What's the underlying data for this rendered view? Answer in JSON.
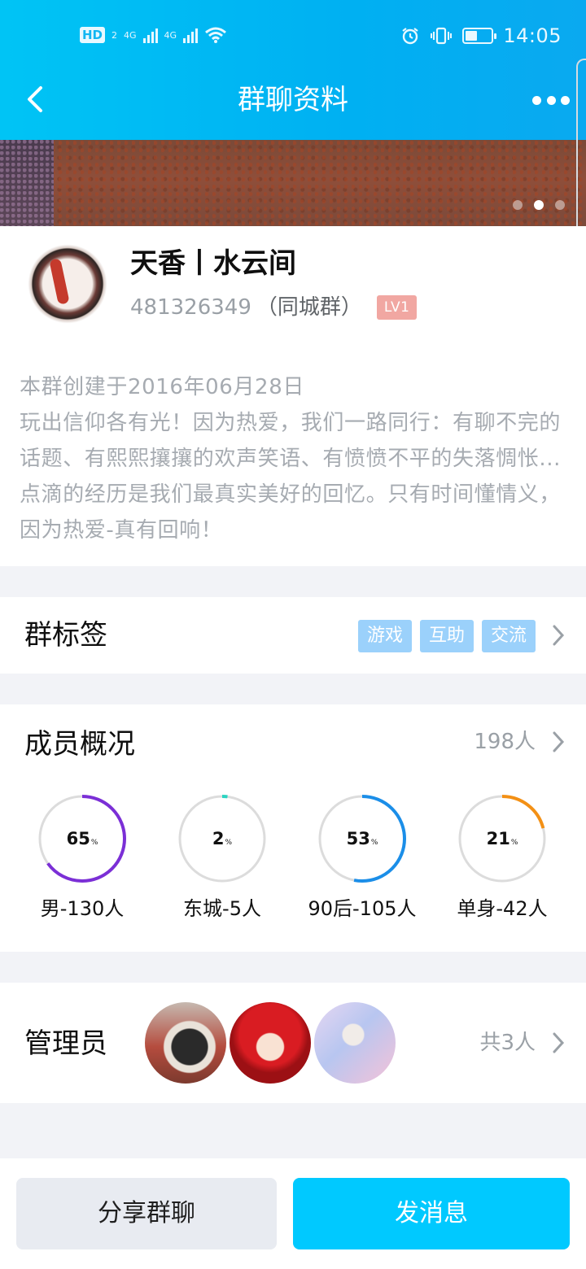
{
  "status_bar": {
    "hd_label": "HD",
    "sim_label": "2",
    "net1": "4G",
    "net2": "4G",
    "wifi_badge": "4",
    "time": "14:05"
  },
  "nav": {
    "title": "群聊资料"
  },
  "group": {
    "name": "天香丨水云间",
    "id": "481326349",
    "type": "（同城群）",
    "level": "LV1",
    "created": "本群创建于2016年06月28日",
    "description": "玩出信仰各有光！因为热爱，我们一路同行：有聊不完的话题、有熙熙攘攘的欢声笑语、有愤愤不平的失落惆怅...点滴的经历是我们最真实美好的回忆。只有时间懂情义，因为热爱-真有回响！"
  },
  "tags_row": {
    "title": "群标签",
    "tags": [
      "游戏",
      "互助",
      "交流"
    ]
  },
  "members_row": {
    "title": "成员概况",
    "count": "198人",
    "stats": [
      {
        "value": 65,
        "pct_text": "65",
        "unit": "%",
        "label": "男-130人",
        "color": "#7b2fd6"
      },
      {
        "value": 2,
        "pct_text": "2",
        "unit": "%",
        "label": "东城-5人",
        "color": "#2cd4c1"
      },
      {
        "value": 53,
        "pct_text": "53",
        "unit": "%",
        "label": "90后-105人",
        "color": "#1b8ee8"
      },
      {
        "value": 21,
        "pct_text": "21",
        "unit": "%",
        "label": "单身-42人",
        "color": "#f39015"
      }
    ]
  },
  "admins_row": {
    "title": "管理员",
    "count": "共3人"
  },
  "bottom": {
    "share_label": "分享群聊",
    "send_label": "发消息"
  },
  "colors": {
    "header_start": "#00c4f5",
    "accent": "#00c9ff",
    "tag_bg": "#9bd1fb",
    "level_badge": "#f1a7a2",
    "ring_track": "#dcdcdc"
  }
}
